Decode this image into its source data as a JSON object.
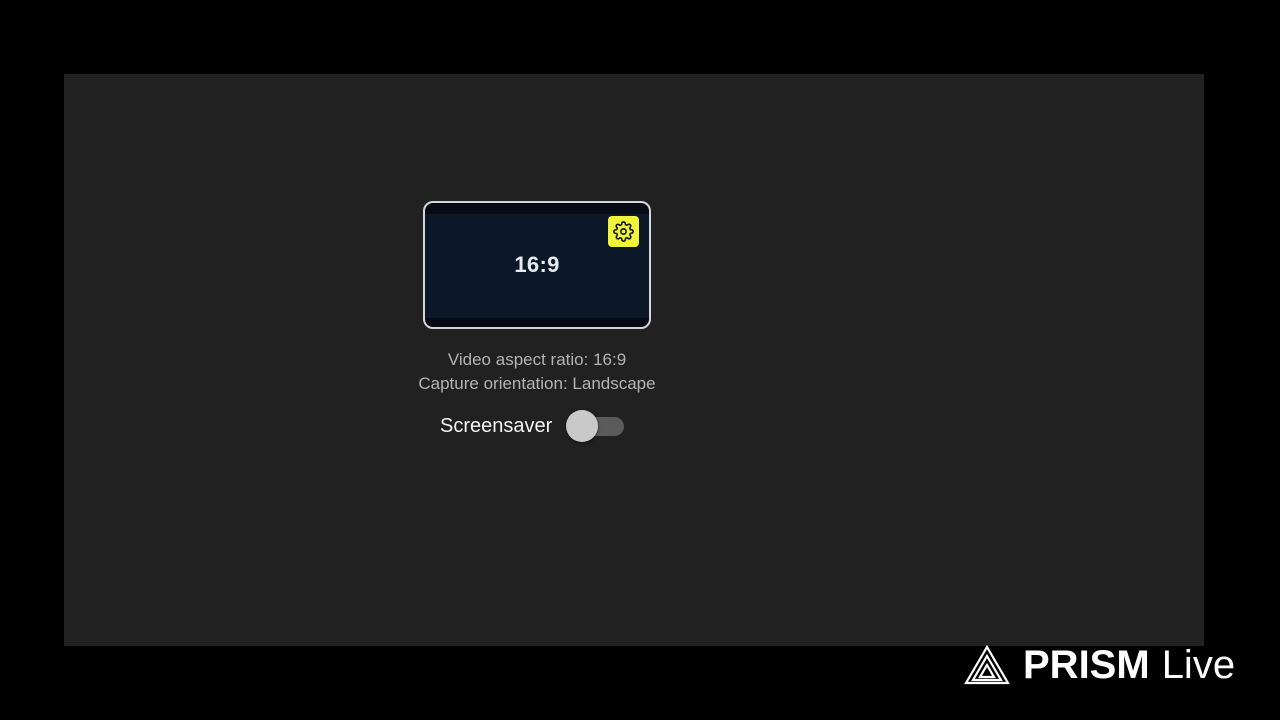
{
  "preview": {
    "ratio_label": "16:9",
    "settings_icon": "gear-icon"
  },
  "info": {
    "aspect_ratio_line": "Video aspect ratio: 16:9",
    "orientation_line": "Capture orientation: Landscape"
  },
  "screensaver": {
    "label": "Screensaver",
    "enabled": false
  },
  "watermark": {
    "brand": "PRISM",
    "product": "Live",
    "logo_icon": "prism-triangle-logo"
  },
  "colors": {
    "background": "#000000",
    "panel": "#212121",
    "accent": "#f1f53a",
    "preview_fill": "#0c1728"
  }
}
